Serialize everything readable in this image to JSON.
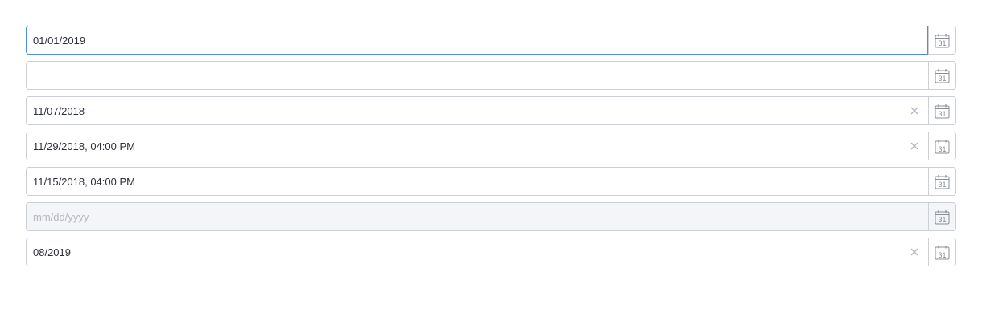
{
  "fields": [
    {
      "value": "01/01/2019",
      "placeholder": "",
      "state": "focused",
      "clearable": false,
      "calendar_icon": "calendar-31-icon"
    },
    {
      "value": "",
      "placeholder": "",
      "state": "normal",
      "clearable": false,
      "calendar_icon": "calendar-31-icon"
    },
    {
      "value": "11/07/2018",
      "placeholder": "",
      "state": "normal",
      "clearable": true,
      "calendar_icon": "calendar-31-icon"
    },
    {
      "value": "11/29/2018, 04:00 PM",
      "placeholder": "",
      "state": "normal",
      "clearable": true,
      "calendar_icon": "calendar-31-icon"
    },
    {
      "value": "11/15/2018, 04:00 PM",
      "placeholder": "",
      "state": "normal",
      "clearable": false,
      "calendar_icon": "calendar-31-icon"
    },
    {
      "value": "",
      "placeholder": "mm/dd/yyyy",
      "state": "disabled",
      "clearable": false,
      "calendar_icon": "calendar-31-icon"
    },
    {
      "value": "08/2019",
      "placeholder": "",
      "state": "normal",
      "clearable": true,
      "calendar_icon": "calendar-31-icon"
    }
  ],
  "calendar_day": "31",
  "colors": {
    "focus_border": "#4a90d9",
    "border": "#ccd0d5",
    "disabled_bg": "#f3f5f8",
    "icon": "#8a8f96",
    "clear_icon": "#b4b8be"
  }
}
